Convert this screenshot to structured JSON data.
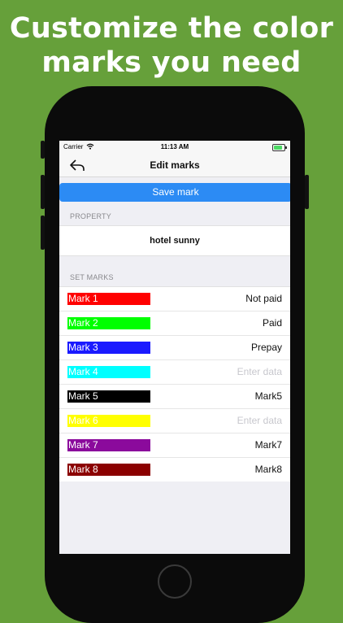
{
  "headline": {
    "line1": "Customize the color",
    "line2": "marks you need"
  },
  "statusbar": {
    "carrier": "Carrier",
    "time": "11:13 AM",
    "wifi_icon": "wifi-icon",
    "battery_icon": "battery-charging-icon"
  },
  "navbar": {
    "title": "Edit marks",
    "back_icon": "back-arrow-icon"
  },
  "save_label": "Save mark",
  "property": {
    "header": "PROPERTY",
    "value": "hotel sunny"
  },
  "marks": {
    "header": "SET MARKS",
    "items": [
      {
        "label": "Mark 1",
        "color": "#ff0000",
        "text_color": "#ffffff",
        "value": "Not paid",
        "placeholder": ""
      },
      {
        "label": "Mark 2",
        "color": "#00ff00",
        "text_color": "#ffffff",
        "value": "Paid",
        "placeholder": ""
      },
      {
        "label": "Mark 3",
        "color": "#1a1aff",
        "text_color": "#ffffff",
        "value": "Prepay",
        "placeholder": ""
      },
      {
        "label": "Mark 4",
        "color": "#00ffff",
        "text_color": "#ffffff",
        "value": "",
        "placeholder": "Enter data"
      },
      {
        "label": "Mark 5",
        "color": "#000000",
        "text_color": "#ffffff",
        "value": "Mark5",
        "placeholder": ""
      },
      {
        "label": "Mark 6",
        "color": "#ffff00",
        "text_color": "#ffffff",
        "value": "",
        "placeholder": "Enter data"
      },
      {
        "label": "Mark 7",
        "color": "#8b0a9c",
        "text_color": "#ffffff",
        "value": "Mark7",
        "placeholder": ""
      },
      {
        "label": "Mark 8",
        "color": "#8b0000",
        "text_color": "#ffffff",
        "value": "Mark8",
        "placeholder": ""
      }
    ]
  }
}
